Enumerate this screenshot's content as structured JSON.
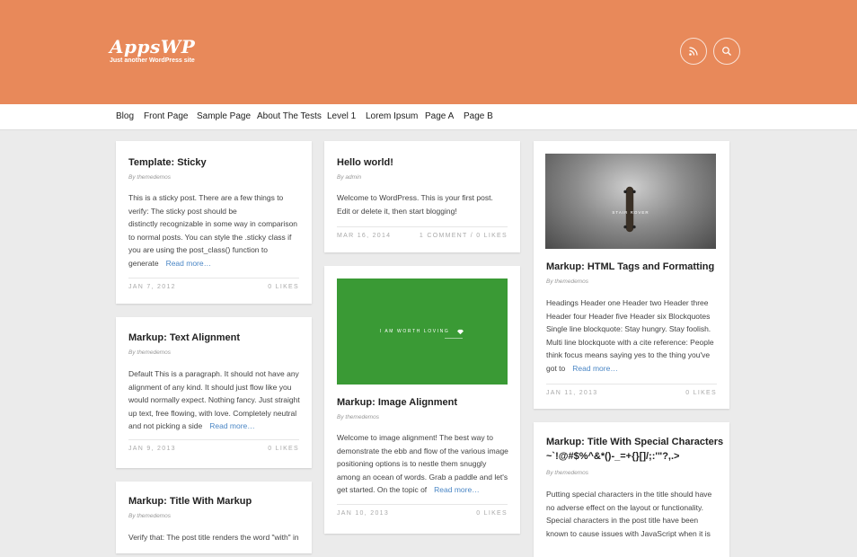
{
  "site": {
    "logo": "AppsWP",
    "tagline": "Just another WordPress site"
  },
  "header_icons": [
    "rss-icon",
    "search-icon"
  ],
  "nav": [
    "Blog",
    "Front Page",
    "Sample Page",
    "About The Tests",
    "Level 1",
    "Lorem Ipsum",
    "Page A",
    "Page B"
  ],
  "posts": {
    "sticky": {
      "title": "Template: Sticky",
      "author": "By themedemos",
      "excerpt": [
        "This is a sticky post. There are a few things to",
        "verify: The sticky post should be",
        "distinctly recognizable in some way in comparison",
        "to normal posts. You can style the .sticky class if",
        "you are using the post_class() function to",
        "generate"
      ],
      "more": "Read more…",
      "date": "JAN 7, 2012",
      "likes": "0 LIKES"
    },
    "text_alignment": {
      "title": "Markup: Text Alignment",
      "author": "By themedemos",
      "excerpt": [
        "Default This is a paragraph. It should not have any",
        "alignment of any kind. It should just flow like you",
        "would normally expect. Nothing fancy. Just straight",
        "up text, free flowing, with love. Completely neutral",
        "and not picking a side"
      ],
      "more": "Read more…",
      "date": "JAN 9, 2013",
      "likes": "0 LIKES"
    },
    "title_markup": {
      "title": "Markup: Title With Markup",
      "author": "By themedemos",
      "excerpt": [
        "Verify that: The post title renders the word \"with\" in"
      ]
    },
    "hello": {
      "title": "Hello world!",
      "author": "By admin",
      "excerpt": [
        "Welcome to WordPress. This is your first post.",
        "Edit or delete it, then start blogging!"
      ],
      "date": "MAR 16, 2014",
      "comments": "1 COMMENT / 0 LIKES"
    },
    "image_alignment": {
      "image_text": "I AM WORTH LOVING",
      "title": "Markup: Image Alignment",
      "author": "By themedemos",
      "excerpt": [
        "Welcome to image alignment! The best way to",
        "demonstrate the ebb and flow of the various image",
        "positioning options is to nestle them snuggly",
        "among an ocean of words. Grab a paddle and let's",
        "get started. On the topic of"
      ],
      "more": "Read more…",
      "date": "JAN 10, 2013",
      "likes": "0 LIKES"
    },
    "html_tags": {
      "image_text": "STAIR ROVER",
      "title": "Markup: HTML Tags and Formatting",
      "author": "By themedemos",
      "excerpt": [
        "Headings Header one Header two Header three",
        "Header four Header five Header six Blockquotes",
        "Single line blockquote: Stay hungry. Stay foolish.",
        "Multi line blockquote with a cite reference: People",
        "think focus means saying yes to the thing you've",
        "got to"
      ],
      "more": "Read more…",
      "date": "JAN 11, 2013",
      "likes": "0 LIKES"
    },
    "special_chars": {
      "title_line1": "Markup: Title With Special Characters",
      "title_line2": "~`!@#$%^&*()-_=+{}[]/;:'\"?,.>",
      "author": "By themedemos",
      "excerpt": [
        "Putting special characters in the title should have",
        "no adverse effect on the layout or functionality.",
        "Special characters in the post title have been",
        "known to cause issues with JavaScript when it is"
      ]
    }
  },
  "colors": {
    "header": "#e8895a",
    "background": "#ebebeb",
    "link": "#4a86c5",
    "image_green": "#3a9a35"
  }
}
